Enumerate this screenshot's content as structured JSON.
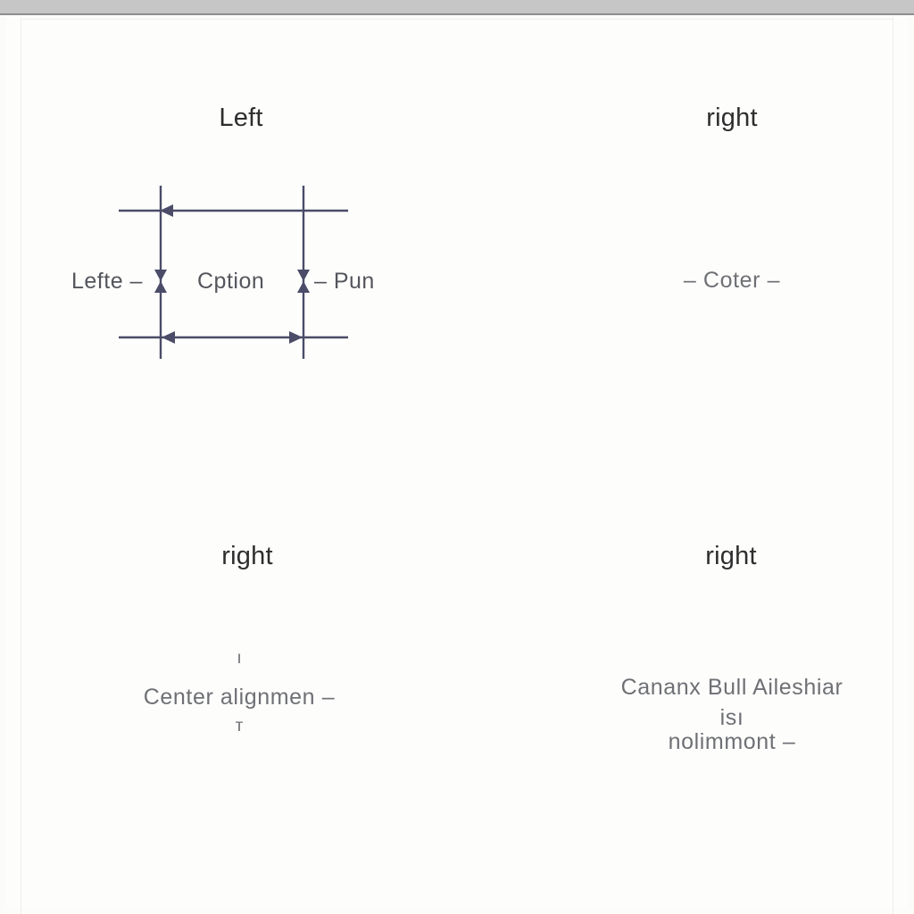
{
  "window": {
    "titlebar_color": "#c6c6c6",
    "canvas_background": "#fdfdfc"
  },
  "colors": {
    "heading_text": "#2e2e2e",
    "body_text": "#5d5f63",
    "diagram_stroke": "#4a4c68",
    "frame_border": "#efefee"
  },
  "quadrants": {
    "top_left": {
      "heading": "Left",
      "diagram": {
        "label_left": "Lefte  –",
        "label_center": "Cption",
        "label_right": "–  Pun"
      }
    },
    "top_right": {
      "heading": "right",
      "line1": "–  Coter  –"
    },
    "bottom_left": {
      "heading": "right",
      "tick_above": "ı",
      "line1": "Center  alignmen  –",
      "tick_below": "т"
    },
    "bottom_right": {
      "heading": "right",
      "line1": "Cananx  Bull  Aileshiar",
      "line2": "isı",
      "line3": "nolimmont  –"
    }
  }
}
